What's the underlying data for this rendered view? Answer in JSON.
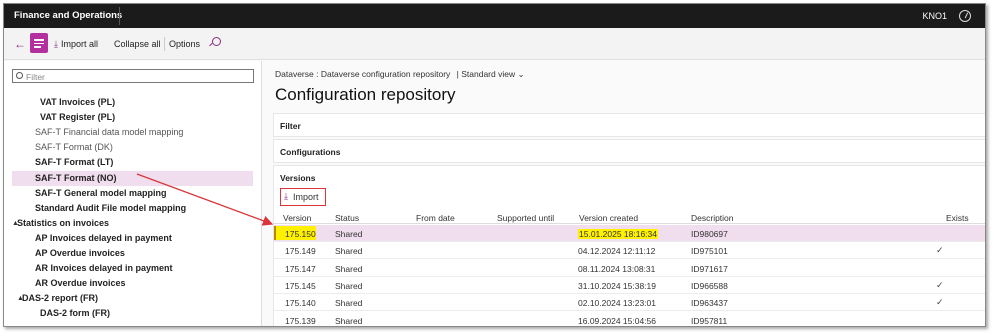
{
  "topbar": {
    "app_title": "Finance and Operations",
    "company": "KNO1",
    "help_icon": "help-icon"
  },
  "actionpane": {
    "import_all": "Import all",
    "collapse_all": "Collapse all",
    "options": "Options"
  },
  "tree": {
    "filter_placeholder": "Filter",
    "items": [
      {
        "label": "VAT Invoices (PL)",
        "bold": true
      },
      {
        "label": "VAT Register (PL)",
        "bold": true
      },
      {
        "label": "SAF-T Financial data model mapping",
        "bold": false
      },
      {
        "label": "SAF-T Format (DK)",
        "bold": false
      },
      {
        "label": "SAF-T Format (LT)",
        "bold": true
      },
      {
        "label": "SAF-T Format (NO)",
        "bold": true,
        "selected": true
      },
      {
        "label": "SAF-T General model mapping",
        "bold": true
      },
      {
        "label": "Standard Audit File model mapping",
        "bold": true
      },
      {
        "label": "Statistics on invoices",
        "bold": true,
        "expander": "▲"
      },
      {
        "label": "AP Invoices delayed in payment",
        "bold": true
      },
      {
        "label": "AP Overdue invoices",
        "bold": true
      },
      {
        "label": "AR Invoices delayed in payment",
        "bold": true
      },
      {
        "label": "AR Overdue invoices",
        "bold": true
      },
      {
        "label": "DAS-2 report (FR)",
        "bold": true,
        "expander": "▲"
      },
      {
        "label": "DAS-2 form (FR)",
        "bold": true
      }
    ]
  },
  "content": {
    "breadcrumb": "Dataverse : Dataverse configuration repository",
    "view": "| Standard view",
    "title": "Configuration repository",
    "fasttabs": {
      "filter": "Filter",
      "configurations": "Configurations",
      "versions": "Versions"
    },
    "import_button": "Import",
    "columns": {
      "version": "Version",
      "status": "Status",
      "from_date": "From date",
      "supported_until": "Supported until",
      "version_created": "Version created",
      "description": "Description",
      "exists": "Exists"
    },
    "rows": [
      {
        "version": "175.150",
        "status": "Shared",
        "created": "15.01.2025 18:16:34",
        "description": "ID980697",
        "exists": false,
        "selected": true
      },
      {
        "version": "175.149",
        "status": "Shared",
        "created": "04.12.2024 12:11:12",
        "description": "ID975101",
        "exists": true
      },
      {
        "version": "175.147",
        "status": "Shared",
        "created": "08.11.2024 13:08:31",
        "description": "ID971617",
        "exists": false
      },
      {
        "version": "175.145",
        "status": "Shared",
        "created": "31.10.2024 15:38:19",
        "description": "ID966588",
        "exists": true
      },
      {
        "version": "175.140",
        "status": "Shared",
        "created": "02.10.2024 13:23:01",
        "description": "ID963437",
        "exists": true
      },
      {
        "version": "175.139",
        "status": "Shared",
        "created": "16.09.2024 15:04:56",
        "description": "ID957811",
        "exists": false
      }
    ]
  },
  "colors": {
    "accent": "#b4309f",
    "highlight": "#fff100",
    "annotation": "#d9353b",
    "selected_row": "#f0dded"
  }
}
